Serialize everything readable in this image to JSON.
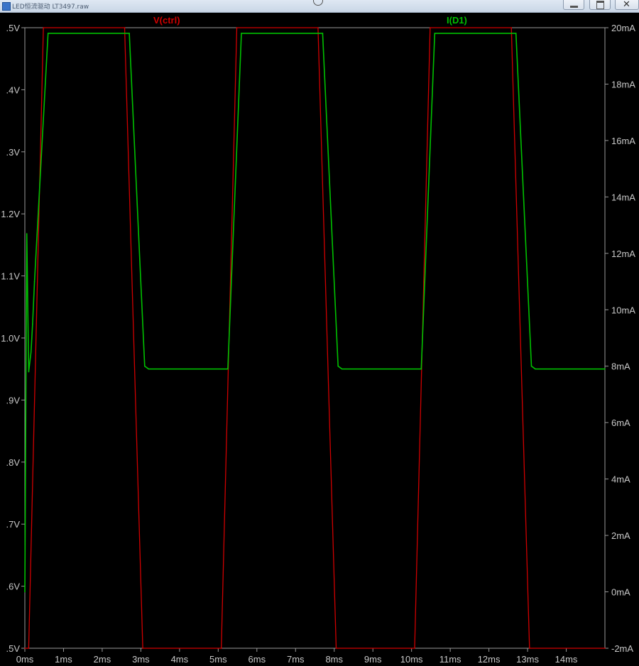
{
  "window": {
    "title": "LED恒流驱动 LT3497.raw",
    "icons": {
      "app": "app-icon",
      "minimize": "minimize-icon",
      "maximize": "maximize-icon",
      "close": "close-icon"
    }
  },
  "chart_data": {
    "type": "line",
    "title": "",
    "xlabel": "",
    "x_ticks": [
      "0ms",
      "1ms",
      "2ms",
      "3ms",
      "4ms",
      "5ms",
      "6ms",
      "7ms",
      "8ms",
      "9ms",
      "10ms",
      "11ms",
      "12ms",
      "13ms",
      "14ms"
    ],
    "xlim": [
      0,
      15
    ],
    "left_axis": {
      "ticks": [
        ".5V",
        ".6V",
        ".7V",
        ".8V",
        ".9V",
        "1.0V",
        "1.1V",
        "1.2V",
        ".3V",
        ".4V",
        ".5V"
      ],
      "range": [
        0.5,
        1.5
      ],
      "unit": "V"
    },
    "right_axis": {
      "ticks": [
        "-2mA",
        "0mA",
        "2mA",
        "4mA",
        "6mA",
        "8mA",
        "10mA",
        "12mA",
        "14mA",
        "16mA",
        "18mA",
        "20mA"
      ],
      "range": [
        -2,
        20
      ],
      "unit": "mA"
    },
    "grid": false,
    "series": [
      {
        "name": "V(ctrl)",
        "axis": "left",
        "color": "#d00000",
        "x": [
          0,
          0.1,
          0.48,
          2.58,
          3.05,
          5.08,
          5.48,
          7.58,
          8.05,
          10.08,
          10.48,
          12.58,
          13.05,
          15
        ],
        "y": [
          0.5,
          0.5,
          1.5,
          1.5,
          0.5,
          0.5,
          1.5,
          1.5,
          0.5,
          0.5,
          1.5,
          1.5,
          0.5,
          0.5
        ]
      },
      {
        "name": "I(D1)",
        "axis": "right",
        "color": "#00c000",
        "x": [
          0,
          0.05,
          0.1,
          0.16,
          0.2,
          0.25,
          0.6,
          2.7,
          3.1,
          3.2,
          5.25,
          5.6,
          7.7,
          8.1,
          8.2,
          10.25,
          10.6,
          12.7,
          13.1,
          13.2,
          15
        ],
        "y": [
          0,
          12.7,
          7.8,
          8.5,
          9.5,
          11,
          19.8,
          19.8,
          8.0,
          7.9,
          7.9,
          19.8,
          19.8,
          8.0,
          7.9,
          7.9,
          19.8,
          19.8,
          8.0,
          7.9,
          7.9
        ]
      }
    ]
  }
}
